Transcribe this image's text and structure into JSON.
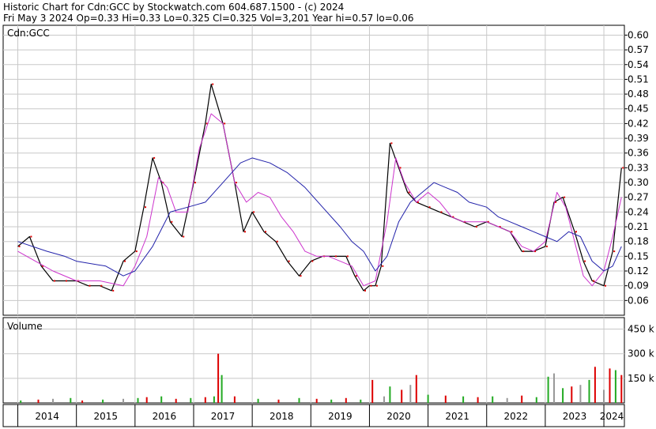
{
  "header": {
    "title": "Historic Chart for Cdn:GCC by Stockwatch.com 604.687.1500 - (c) 2024",
    "summary": "Fri May  3 2024  Op=0.33  Hi=0.33  Lo=0.325  Cl=0.325  Vol=3,201  Year hi=0.57  lo=0.06"
  },
  "chart_data": [
    {
      "type": "line",
      "label": "Cdn:GCC",
      "ylim": [
        0.03,
        0.62
      ],
      "y_ticks": [
        "0.60",
        "0.57",
        "0.54",
        "0.51",
        "0.48",
        "0.45",
        "0.42",
        "0.39",
        "0.36",
        "0.33",
        "0.30",
        "0.27",
        "0.24",
        "0.21",
        "0.18",
        "0.15",
        "0.12",
        "0.09",
        "0.06"
      ],
      "grid": true,
      "series": [
        {
          "style": "price",
          "color": "#000000",
          "x": [
            2014.0,
            2014.2,
            2014.4,
            2014.6,
            2014.8,
            2015.0,
            2015.2,
            2015.4,
            2015.6,
            2015.8,
            2016.0,
            2016.15,
            2016.3,
            2016.45,
            2016.6,
            2016.8,
            2017.0,
            2017.2,
            2017.3,
            2017.5,
            2017.7,
            2017.85,
            2018.0,
            2018.2,
            2018.4,
            2018.6,
            2018.8,
            2019.0,
            2019.2,
            2019.4,
            2019.6,
            2019.75,
            2019.9,
            2020.0,
            2020.1,
            2020.2,
            2020.35,
            2020.5,
            2020.65,
            2020.8,
            2021.0,
            2021.2,
            2021.4,
            2021.6,
            2021.8,
            2022.0,
            2022.2,
            2022.4,
            2022.6,
            2022.8,
            2023.0,
            2023.15,
            2023.3,
            2023.5,
            2023.65,
            2023.8,
            2024.0,
            2024.15,
            2024.3
          ],
          "y": [
            0.17,
            0.19,
            0.13,
            0.1,
            0.1,
            0.1,
            0.09,
            0.09,
            0.08,
            0.14,
            0.16,
            0.25,
            0.35,
            0.3,
            0.22,
            0.19,
            0.3,
            0.42,
            0.5,
            0.42,
            0.3,
            0.2,
            0.24,
            0.2,
            0.18,
            0.14,
            0.11,
            0.14,
            0.15,
            0.15,
            0.15,
            0.11,
            0.08,
            0.09,
            0.09,
            0.13,
            0.38,
            0.33,
            0.28,
            0.26,
            0.25,
            0.24,
            0.23,
            0.22,
            0.21,
            0.22,
            0.21,
            0.2,
            0.16,
            0.16,
            0.17,
            0.26,
            0.27,
            0.2,
            0.14,
            0.1,
            0.09,
            0.16,
            0.33
          ]
        },
        {
          "style": "short-moving-average",
          "color": "#cc33cc",
          "x": [
            2014.0,
            2014.3,
            2014.6,
            2015.0,
            2015.4,
            2015.8,
            2016.0,
            2016.2,
            2016.4,
            2016.55,
            2016.7,
            2016.9,
            2017.1,
            2017.3,
            2017.5,
            2017.7,
            2017.9,
            2018.1,
            2018.3,
            2018.5,
            2018.7,
            2018.9,
            2019.1,
            2019.3,
            2019.5,
            2019.7,
            2019.9,
            2020.1,
            2020.3,
            2020.45,
            2020.6,
            2020.8,
            2021.0,
            2021.2,
            2021.4,
            2021.6,
            2021.8,
            2022.0,
            2022.2,
            2022.4,
            2022.6,
            2022.8,
            2023.0,
            2023.2,
            2023.35,
            2023.5,
            2023.65,
            2023.8,
            2024.0,
            2024.15,
            2024.3
          ],
          "y": [
            0.16,
            0.14,
            0.12,
            0.1,
            0.1,
            0.09,
            0.13,
            0.19,
            0.31,
            0.29,
            0.24,
            0.24,
            0.37,
            0.44,
            0.42,
            0.3,
            0.26,
            0.28,
            0.27,
            0.23,
            0.2,
            0.16,
            0.15,
            0.15,
            0.14,
            0.13,
            0.09,
            0.1,
            0.22,
            0.35,
            0.3,
            0.26,
            0.28,
            0.26,
            0.23,
            0.22,
            0.22,
            0.22,
            0.21,
            0.2,
            0.17,
            0.16,
            0.18,
            0.28,
            0.25,
            0.18,
            0.11,
            0.09,
            0.12,
            0.19,
            0.27
          ]
        },
        {
          "style": "long-moving-average",
          "color": "#2222aa",
          "x": [
            2014.0,
            2014.5,
            2014.8,
            2015.0,
            2015.5,
            2015.8,
            2016.0,
            2016.3,
            2016.6,
            2016.9,
            2017.2,
            2017.5,
            2017.8,
            2018.0,
            2018.3,
            2018.6,
            2018.9,
            2019.2,
            2019.5,
            2019.7,
            2019.9,
            2020.1,
            2020.3,
            2020.5,
            2020.7,
            2020.9,
            2021.1,
            2021.3,
            2021.5,
            2021.7,
            2022.0,
            2022.2,
            2022.4,
            2022.6,
            2022.8,
            2023.0,
            2023.2,
            2023.4,
            2023.6,
            2023.8,
            2024.0,
            2024.15,
            2024.3
          ],
          "y": [
            0.18,
            0.16,
            0.15,
            0.14,
            0.13,
            0.11,
            0.12,
            0.17,
            0.24,
            0.25,
            0.26,
            0.3,
            0.34,
            0.35,
            0.34,
            0.32,
            0.29,
            0.25,
            0.21,
            0.18,
            0.16,
            0.12,
            0.15,
            0.22,
            0.26,
            0.28,
            0.3,
            0.29,
            0.28,
            0.26,
            0.25,
            0.23,
            0.22,
            0.21,
            0.2,
            0.19,
            0.18,
            0.2,
            0.19,
            0.14,
            0.12,
            0.13,
            0.17
          ]
        }
      ]
    },
    {
      "type": "bar",
      "label": "Volume",
      "ylim": [
        0,
        520
      ],
      "y_ticks": [
        "450 k",
        "300 k",
        "150 k"
      ],
      "grid": true,
      "x": [
        2014.05,
        2014.35,
        2014.6,
        2014.9,
        2015.1,
        2015.45,
        2015.8,
        2016.05,
        2016.2,
        2016.45,
        2016.7,
        2016.95,
        2017.2,
        2017.35,
        2017.42,
        2017.48,
        2017.7,
        2018.1,
        2018.45,
        2018.8,
        2019.1,
        2019.35,
        2019.6,
        2019.85,
        2020.05,
        2020.25,
        2020.35,
        2020.55,
        2020.7,
        2020.8,
        2021.0,
        2021.3,
        2021.6,
        2021.85,
        2022.1,
        2022.35,
        2022.6,
        2022.85,
        2023.05,
        2023.15,
        2023.3,
        2023.45,
        2023.6,
        2023.75,
        2023.85,
        2024.0,
        2024.1,
        2024.2,
        2024.3
      ],
      "values": [
        15,
        20,
        25,
        30,
        15,
        20,
        25,
        30,
        35,
        40,
        25,
        30,
        35,
        40,
        300,
        170,
        40,
        25,
        20,
        30,
        25,
        20,
        30,
        20,
        140,
        40,
        100,
        80,
        110,
        170,
        50,
        45,
        40,
        35,
        40,
        30,
        45,
        35,
        160,
        180,
        90,
        100,
        110,
        140,
        220,
        80,
        210,
        200,
        170
      ],
      "colors": [
        "green",
        "red",
        "grey",
        "green",
        "red",
        "green",
        "grey",
        "green",
        "red",
        "green",
        "red",
        "green",
        "red",
        "green",
        "red",
        "green",
        "red",
        "green",
        "red",
        "green",
        "red",
        "green",
        "red",
        "green",
        "red",
        "grey",
        "green",
        "red",
        "grey",
        "red",
        "green",
        "red",
        "green",
        "red",
        "green",
        "grey",
        "red",
        "green",
        "green",
        "grey",
        "green",
        "red",
        "grey",
        "green",
        "red",
        "grey",
        "red",
        "green",
        "red"
      ]
    },
    {
      "type": "table",
      "label": "time-axis",
      "x_ticks": [
        "2014",
        "2015",
        "2016",
        "2017",
        "2018",
        "2019",
        "2020",
        "2021",
        "2022",
        "2023",
        "2024"
      ]
    }
  ]
}
